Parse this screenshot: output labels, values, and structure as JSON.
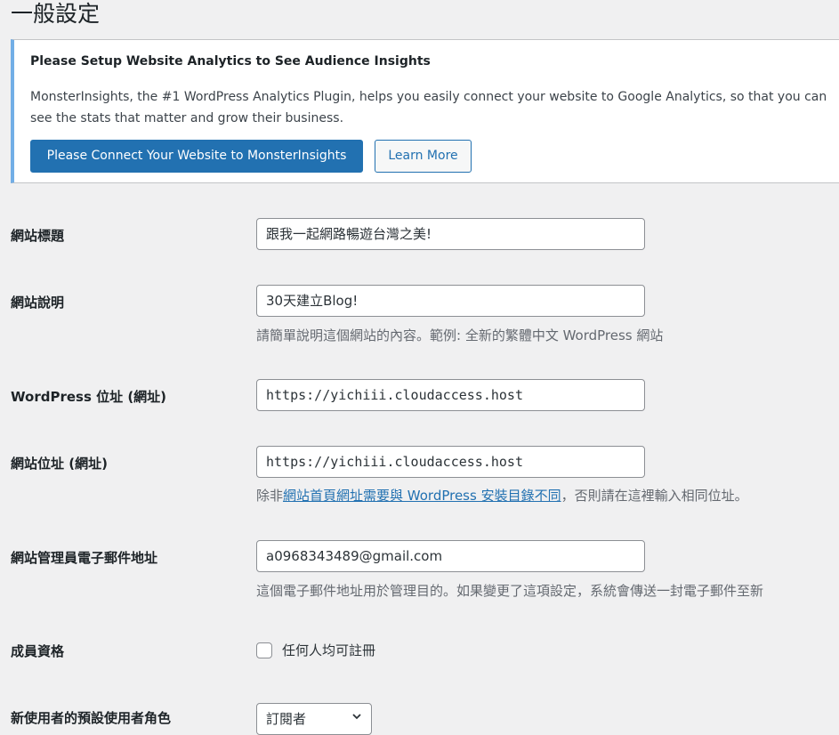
{
  "page": {
    "title": "一般設定"
  },
  "notice": {
    "title": "Please Setup Website Analytics to See Audience Insights",
    "text": "MonsterInsights, the #1 WordPress Analytics Plugin, helps you easily connect your website to Google Analytics, so that you can see the stats that matter and grow their business.",
    "primary_button": "Please Connect Your Website to MonsterInsights",
    "secondary_button": "Learn More"
  },
  "fields": {
    "site_title": {
      "label": "網站標題",
      "value": "跟我一起網路暢遊台灣之美!"
    },
    "tagline": {
      "label": "網站說明",
      "value": "30天建立Blog!",
      "description": "請簡單說明這個網站的內容。範例: 全新的繁體中文 WordPress 網站"
    },
    "wp_address": {
      "label": "WordPress 位址 (網址)",
      "value": "https://yichiii.cloudaccess.host"
    },
    "site_address": {
      "label": "網站位址 (網址)",
      "value": "https://yichiii.cloudaccess.host",
      "description_prefix": "除非",
      "description_link": "網站首頁網址需要與 WordPress 安裝目錄不同",
      "description_suffix": "，否則請在這裡輸入相同位址。"
    },
    "admin_email": {
      "label": "網站管理員電子郵件地址",
      "value": "a0968343489@gmail.com",
      "description": "這個電子郵件地址用於管理目的。如果變更了這項設定，系統會傳送一封電子郵件至新"
    },
    "membership": {
      "label": "成員資格",
      "checkbox_label": "任何人均可註冊",
      "checked": false
    },
    "default_role": {
      "label": "新使用者的預設使用者角色",
      "value": "訂閱者"
    }
  }
}
